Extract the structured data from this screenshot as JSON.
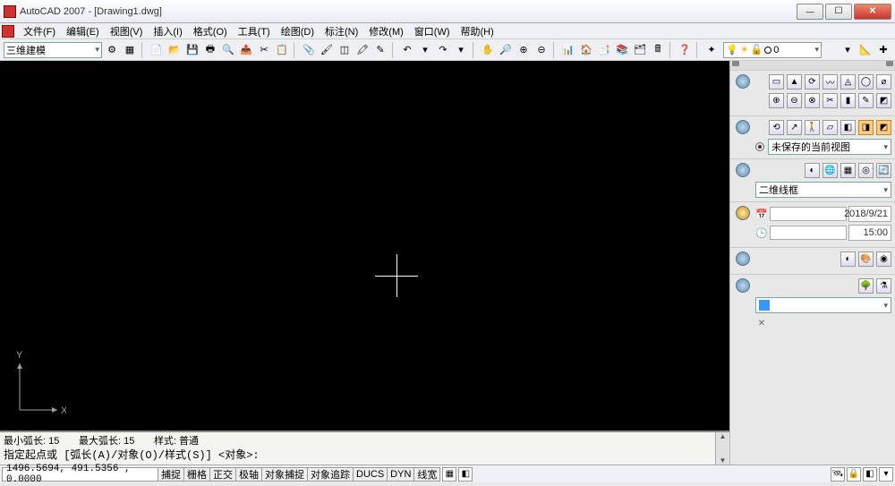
{
  "titlebar": {
    "title": "AutoCAD 2007 - [Drawing1.dwg]"
  },
  "menu": {
    "items": [
      "文件(F)",
      "编辑(E)",
      "视图(V)",
      "插入(I)",
      "格式(O)",
      "工具(T)",
      "绘图(D)",
      "标注(N)",
      "修改(M)",
      "窗口(W)",
      "帮助(H)"
    ]
  },
  "toolbar": {
    "workspace": "三维建模",
    "layer_label": "0"
  },
  "canvas": {
    "ucs_x": "X",
    "ucs_y": "Y"
  },
  "dashboard": {
    "view_select": "未保存的当前视图",
    "style_select": "二维线框",
    "date": "2018/9/21",
    "time": "15:00",
    "light_select": ""
  },
  "command": {
    "line1_a": "最小弧长: 15",
    "line1_b": "最大弧长: 15",
    "line1_c": "样式: 普通",
    "line2": "指定起点或 [弧长(A)/对象(O)/样式(S)] <对象>:"
  },
  "status": {
    "coords": "1496.5694, 491.5356 , 0.0000",
    "buttons": [
      "捕捉",
      "栅格",
      "正交",
      "极轴",
      "对象捕捉",
      "对象追踪",
      "DUCS",
      "DYN",
      "线宽"
    ]
  }
}
